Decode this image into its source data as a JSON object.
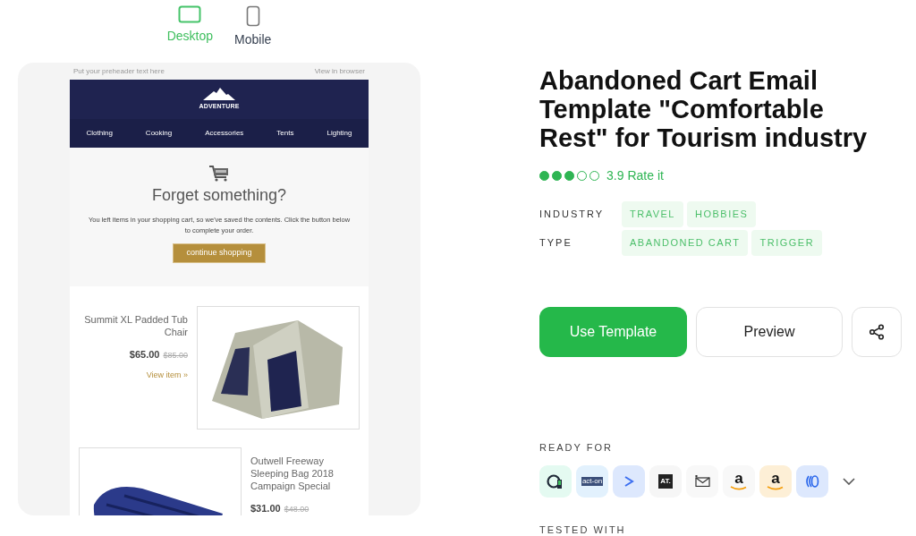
{
  "view_toggle": [
    {
      "label": "Desktop",
      "kind": "desktop",
      "selected": true
    },
    {
      "label": "Mobile",
      "kind": "mobile",
      "selected": false
    }
  ],
  "email": {
    "preheader": "Put your preheader text here",
    "view_in_browser": "View in browser",
    "brand": "ADVENTURE",
    "nav": [
      "Clothing",
      "Cooking",
      "Accessories",
      "Tents",
      "Lighting"
    ],
    "heading": "Forget something?",
    "body": "You left items in your shopping cart, so we've saved the contents. Click the button below to complete your order.",
    "cta": "continue shopping",
    "products": [
      {
        "name": "Summit XL Padded Tub Chair",
        "price": "$65.00",
        "old_price": "$85.00",
        "link": "View item »",
        "kind": "tent"
      },
      {
        "name": "Outwell Freeway Sleeping Bag 2018 Campaign Special",
        "price": "$31.00",
        "old_price": "$48.00",
        "kind": "sleeping-bag"
      }
    ]
  },
  "title": "Abandoned Cart Email Template \"Comfortable Rest\" for Tourism industry",
  "rating": {
    "stars": 3,
    "value": "3.9",
    "action": "Rate it"
  },
  "tags": [
    {
      "label": "INDUSTRY",
      "values": [
        "TRAVEL",
        "HOBBIES"
      ]
    },
    {
      "label": "TYPE",
      "values": [
        "ABANDONED CART",
        "TRIGGER"
      ]
    }
  ],
  "buttons": {
    "primary": "Use Template",
    "secondary": "Preview"
  },
  "ready_for": {
    "label": "READY FOR",
    "integrations": [
      {
        "kind": "circle"
      },
      {
        "kind": "acton",
        "text": "act-on"
      },
      {
        "kind": "chevron"
      },
      {
        "kind": "at",
        "text": "AT."
      },
      {
        "kind": "mail"
      },
      {
        "kind": "amazon",
        "text": "a"
      },
      {
        "kind": "amazon-orange",
        "text": "a"
      },
      {
        "kind": "waves"
      }
    ]
  },
  "tested_with": "TESTED WITH"
}
